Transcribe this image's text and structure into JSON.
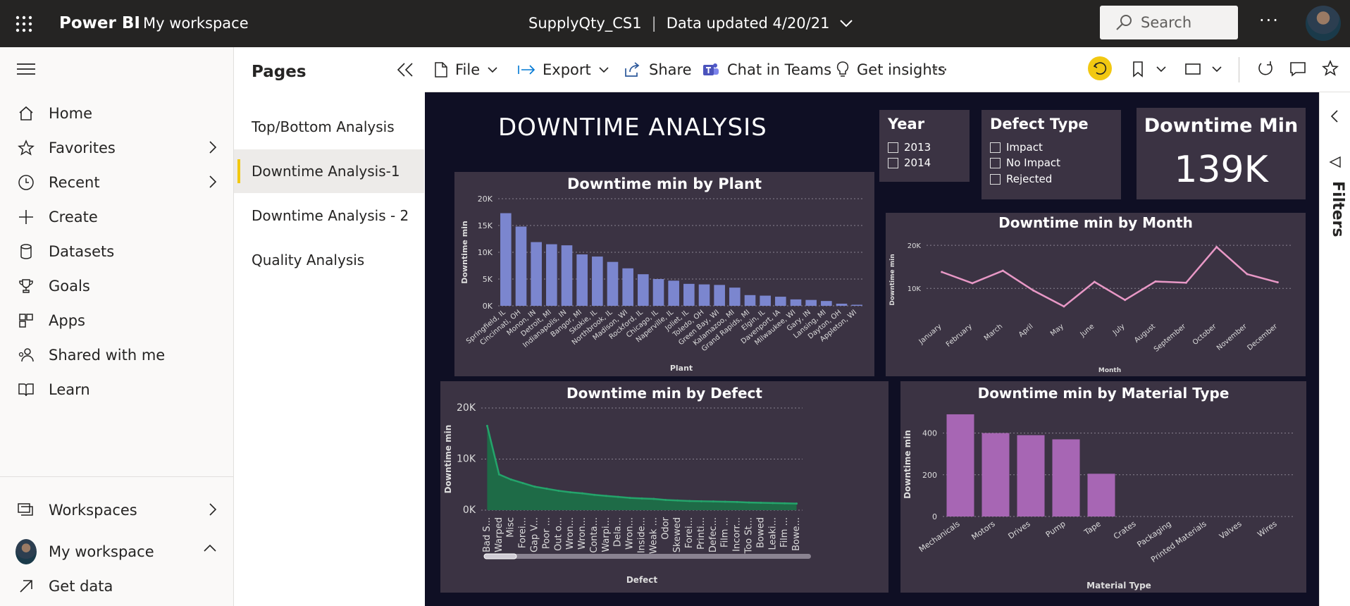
{
  "topbar": {
    "brand": "Power BI",
    "workspace": "My workspace",
    "report_name": "SupplyQty_CS1",
    "separator": "|",
    "data_updated": "Data updated 4/20/21",
    "search_placeholder": "Search",
    "more": "···"
  },
  "leftnav": {
    "items": [
      {
        "label": "Home",
        "icon": "home-icon"
      },
      {
        "label": "Favorites",
        "icon": "star-icon"
      },
      {
        "label": "Recent",
        "icon": "clock-icon"
      },
      {
        "label": "Create",
        "icon": "plus-icon"
      },
      {
        "label": "Datasets",
        "icon": "database-icon"
      },
      {
        "label": "Goals",
        "icon": "trophy-icon"
      },
      {
        "label": "Apps",
        "icon": "apps-icon"
      },
      {
        "label": "Shared with me",
        "icon": "shared-icon"
      },
      {
        "label": "Learn",
        "icon": "book-icon"
      }
    ],
    "bottom": [
      {
        "label": "Workspaces",
        "icon": "workspaces-icon"
      },
      {
        "label": "My workspace",
        "icon": "avatar"
      },
      {
        "label": "Get data",
        "icon": "arrow-up-right-icon"
      }
    ]
  },
  "pages": {
    "title": "Pages",
    "items": [
      "Top/Bottom Analysis",
      "Downtime Analysis-1",
      "Downtime Analysis - 2",
      "Quality Analysis"
    ],
    "active": "Downtime Analysis-1"
  },
  "toolbar": {
    "file": "File",
    "export": "Export",
    "share": "Share",
    "chat": "Chat in Teams",
    "insights": "Get insights",
    "more": "···"
  },
  "report": {
    "title": "DOWNTIME ANALYSIS",
    "year_slicer": {
      "title": "Year",
      "options": [
        "2013",
        "2014"
      ]
    },
    "defect_slicer": {
      "title": "Defect Type",
      "options": [
        "Impact",
        "No Impact",
        "Rejected"
      ]
    },
    "kpi": {
      "title": "Downtime Min",
      "value": "139K"
    }
  },
  "filters_label": "Filters",
  "colors": {
    "plant_bar": "#7b86cf",
    "month_line": "#e898c6",
    "defect_area": "#1e6b47",
    "defect_line": "#24a46b",
    "material_bar": "#a766b4",
    "canvas": "#0f0f24",
    "tile": "#3b3343",
    "accent": "#f2c811"
  },
  "chart_data": [
    {
      "id": "plant",
      "type": "bar",
      "title": "Downtime min by Plant",
      "xlabel": "Plant",
      "ylabel": "Downtime min",
      "ylim": [
        0,
        20000
      ],
      "yticks": [
        "0K",
        "5K",
        "10K",
        "15K",
        "20K"
      ],
      "categories": [
        "Springfield, IL",
        "Cincinnati, OH",
        "Monon, IN",
        "Detroit, MI",
        "Indianapolis, IN",
        "Bangor, MI",
        "Skokie, IL",
        "Northbrook, IL",
        "Madison, WI",
        "Rockford, IL",
        "Chicago, IL",
        "Naperville, IL",
        "Joliet, IL",
        "Toledo, OH",
        "Green Bay, WI",
        "Kalamazoo, MI",
        "Grand Rapids, MI",
        "Elgin, IL",
        "Davenport, IA",
        "Milwaukee, WI",
        "Gary, IN",
        "Lansing, MI",
        "Dayton, OH",
        "Appleton, WI"
      ],
      "values": [
        17300,
        14800,
        11900,
        11500,
        11300,
        9600,
        9200,
        8200,
        7000,
        5900,
        5000,
        4700,
        4100,
        4000,
        3900,
        3400,
        2000,
        1900,
        1700,
        1200,
        1100,
        900,
        400,
        200
      ]
    },
    {
      "id": "month",
      "type": "line",
      "title": "Downtime min by Month",
      "xlabel": "Month",
      "ylabel": "Downtime min",
      "ylim": [
        3000,
        21000
      ],
      "yticks": [
        "10K",
        "20K"
      ],
      "categories": [
        "January",
        "February",
        "March",
        "April",
        "May",
        "June",
        "July",
        "August",
        "September",
        "October",
        "November",
        "December"
      ],
      "values": [
        13800,
        11200,
        14100,
        9500,
        5800,
        11500,
        7300,
        11600,
        11300,
        19600,
        13300,
        11400
      ]
    },
    {
      "id": "defect",
      "type": "area",
      "title": "Downtime min by Defect",
      "xlabel": "Defect",
      "ylabel": "Downtime min",
      "ylim": [
        0,
        20000
      ],
      "yticks": [
        "0K",
        "10K",
        "20K"
      ],
      "categories": [
        "Bad S...",
        "Warped",
        "Misc",
        "Forei...",
        "Gap V...",
        "Poor ...",
        "Out o...",
        "Wron...",
        "Wron...",
        "Conta...",
        "Warpi...",
        "Dela...",
        "Wron...",
        "Inside...",
        "Weak ...",
        "Odor",
        "Skewed",
        "Forei...",
        "Printi...",
        "Defec...",
        "Film ...",
        "Incorr...",
        "Too St...",
        "Bowed",
        "Leaki...",
        "Film ...",
        "Bowe..."
      ],
      "values": [
        16500,
        7000,
        6000,
        5300,
        4600,
        4200,
        3800,
        3500,
        3300,
        3000,
        2800,
        2600,
        2400,
        2300,
        2200,
        2000,
        1900,
        1800,
        1750,
        1700,
        1650,
        1600,
        1500,
        1450,
        1400,
        1350,
        1300
      ]
    },
    {
      "id": "material",
      "type": "bar",
      "title": "Downtime min by Material Type",
      "xlabel": "Material Type",
      "ylabel": "Downtime min",
      "ylim": [
        0,
        500
      ],
      "yticks": [
        "0",
        "200",
        "400"
      ],
      "categories": [
        "Mechanicals",
        "Motors",
        "Drives",
        "Pump",
        "Tape",
        "Crates",
        "Packaging",
        "Printed Materials",
        "Valves",
        "Wires"
      ],
      "values": [
        490,
        400,
        390,
        370,
        205,
        0,
        0,
        0,
        0,
        0
      ]
    }
  ]
}
